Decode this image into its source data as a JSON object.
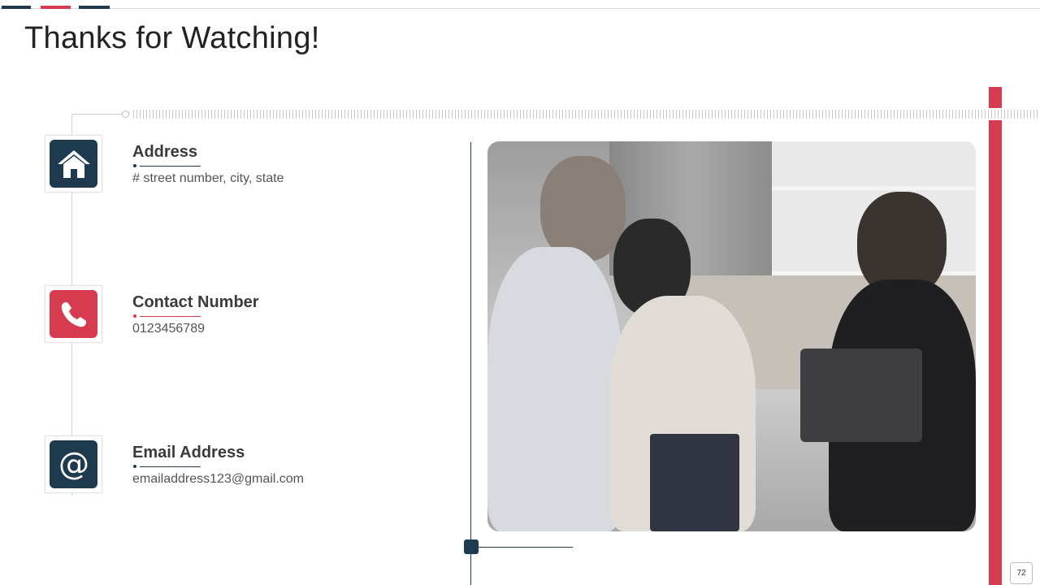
{
  "slide": {
    "title": "Thanks for Watching!",
    "page_number": "72"
  },
  "contacts": [
    {
      "title": "Address",
      "value": "# street number, city, state",
      "icon": "home-icon"
    },
    {
      "title": "Contact Number",
      "value": "0123456789",
      "icon": "phone-icon"
    },
    {
      "title": "Email Address",
      "value": "emailaddress123@gmail.com",
      "icon": "at-sign-icon"
    }
  ],
  "colors": {
    "navy": "#1e3a4f",
    "red": "#d63b4f"
  },
  "image": {
    "subject": "photo-handshake"
  }
}
